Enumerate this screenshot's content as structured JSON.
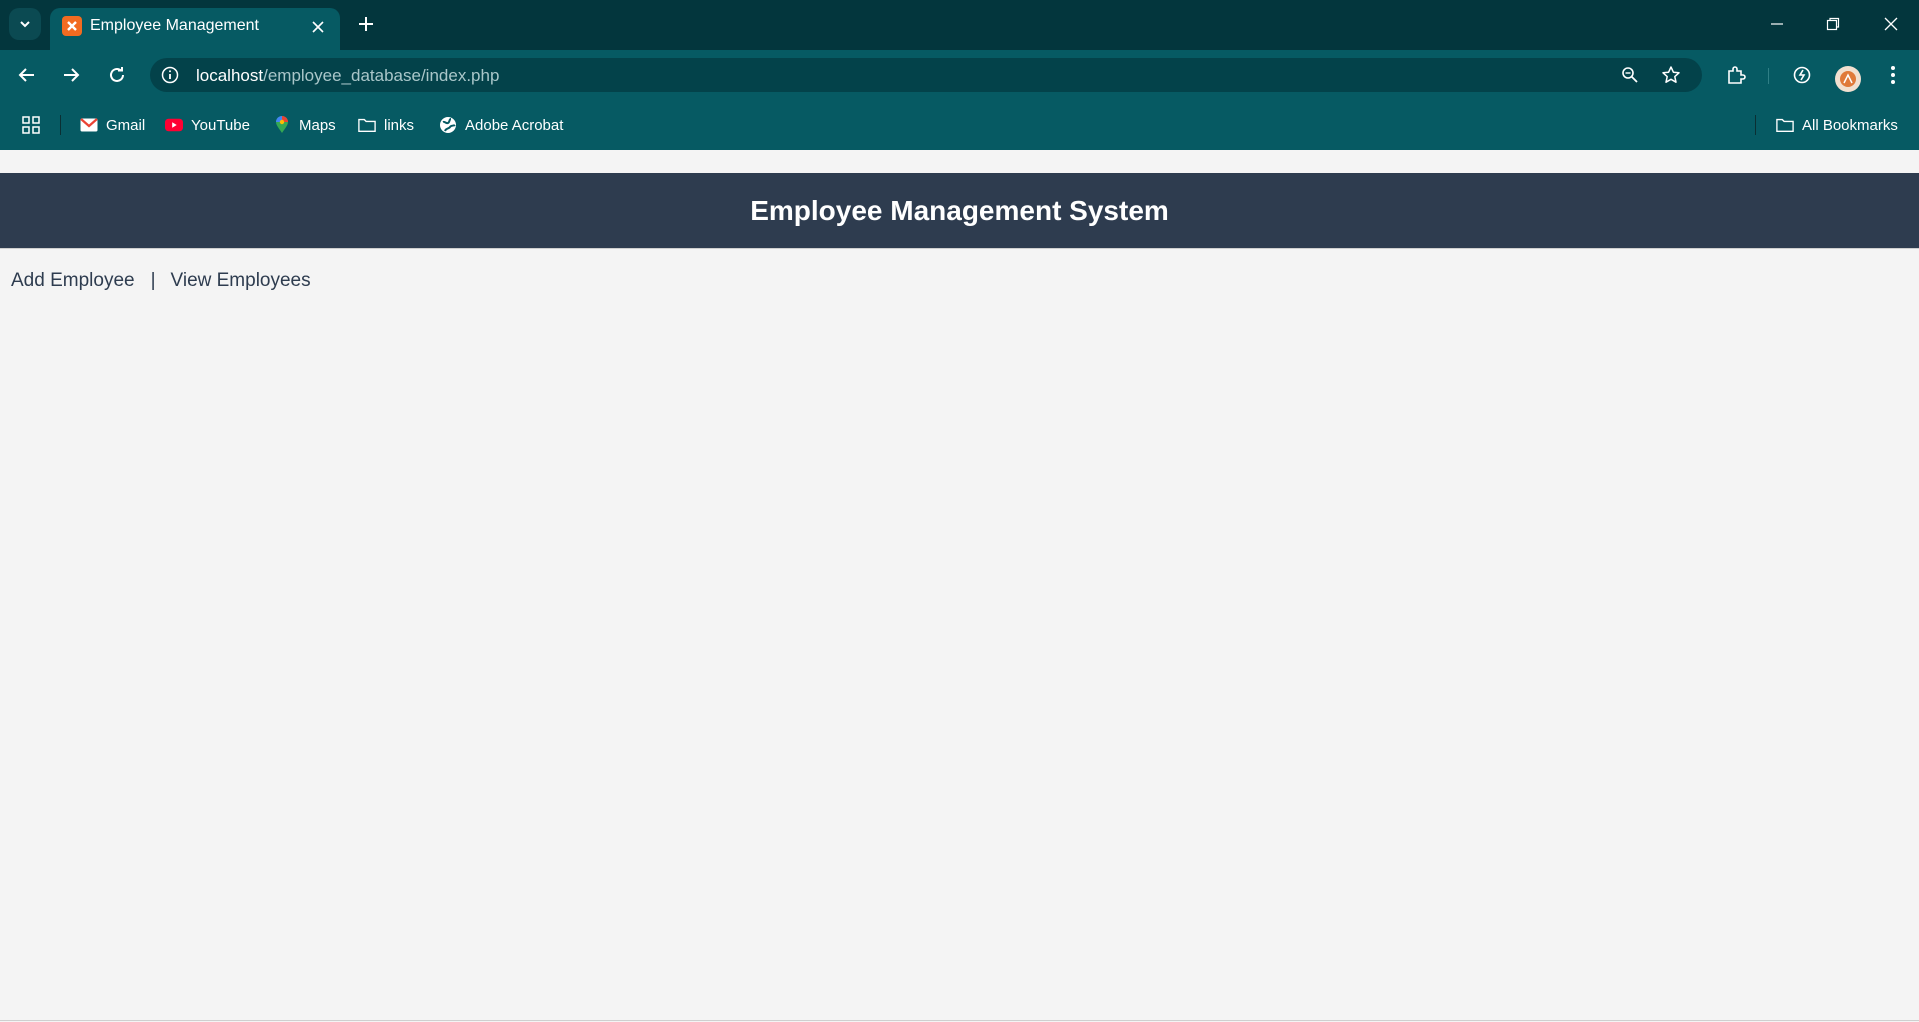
{
  "browser": {
    "tab": {
      "title": "Employee Management"
    },
    "url": {
      "host": "localhost",
      "path": "/employee_database/index.php"
    },
    "bookmarks": [
      {
        "label": "Gmail",
        "icon": "gmail-icon"
      },
      {
        "label": "YouTube",
        "icon": "youtube-icon"
      },
      {
        "label": "Maps",
        "icon": "maps-icon"
      },
      {
        "label": "links",
        "icon": "folder-icon"
      },
      {
        "label": "Adobe Acrobat",
        "icon": "globe-icon"
      }
    ],
    "all_bookmarks_label": "All Bookmarks",
    "colors": {
      "tabstrip": "#03363d",
      "toolbar": "#065a63",
      "favicon": "#f26b21"
    }
  },
  "page": {
    "header_title": "Employee Management System",
    "nav": {
      "add_label": "Add Employee",
      "separator": "|",
      "view_label": "View Employees"
    },
    "colors": {
      "header_bg": "#2e3c4f",
      "body_bg": "#f4f4f4"
    }
  }
}
